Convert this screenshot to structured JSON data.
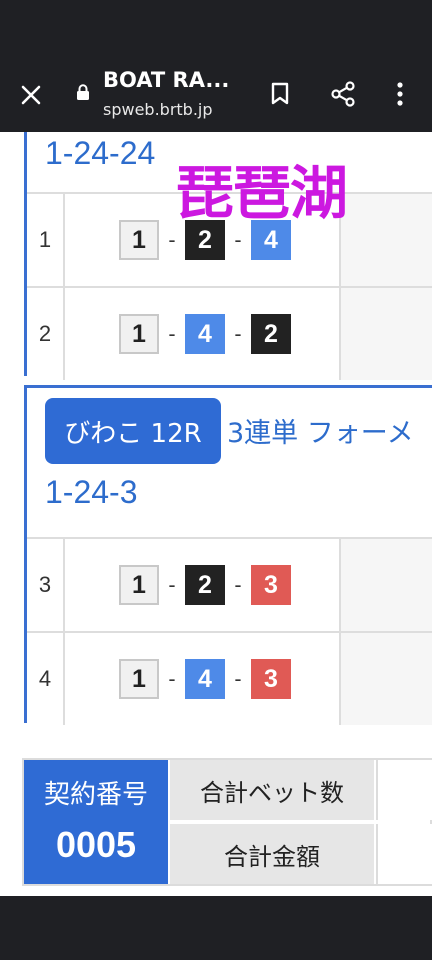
{
  "toolbar": {
    "title": "BOAT RA...",
    "url": "spweb.brtb.jp"
  },
  "watermark": "琵琶湖",
  "card1": {
    "combo_label": "1-24-24",
    "rows": [
      {
        "index": "1",
        "numbers": [
          "1",
          "2",
          "4"
        ]
      },
      {
        "index": "2",
        "numbers": [
          "1",
          "4",
          "2"
        ]
      }
    ]
  },
  "card2": {
    "venue_badge": "びわこ 12R",
    "bet_type": "3連単 フォーメ",
    "combo_label": "1-24-3",
    "rows": [
      {
        "index": "3",
        "numbers": [
          "1",
          "2",
          "3"
        ]
      },
      {
        "index": "4",
        "numbers": [
          "1",
          "4",
          "3"
        ]
      }
    ]
  },
  "summary": {
    "contract_label": "契約番号",
    "contract_number": "0005",
    "total_bets_label": "合計ベット数",
    "total_amount_label": "合計金額"
  },
  "colors": {
    "accent_blue": "#2f6bd4",
    "boat_1": "#f1f1f1",
    "boat_2": "#222222",
    "boat_3": "#e05a55",
    "boat_4": "#4e8ae8",
    "watermark": "#cc18e0"
  }
}
